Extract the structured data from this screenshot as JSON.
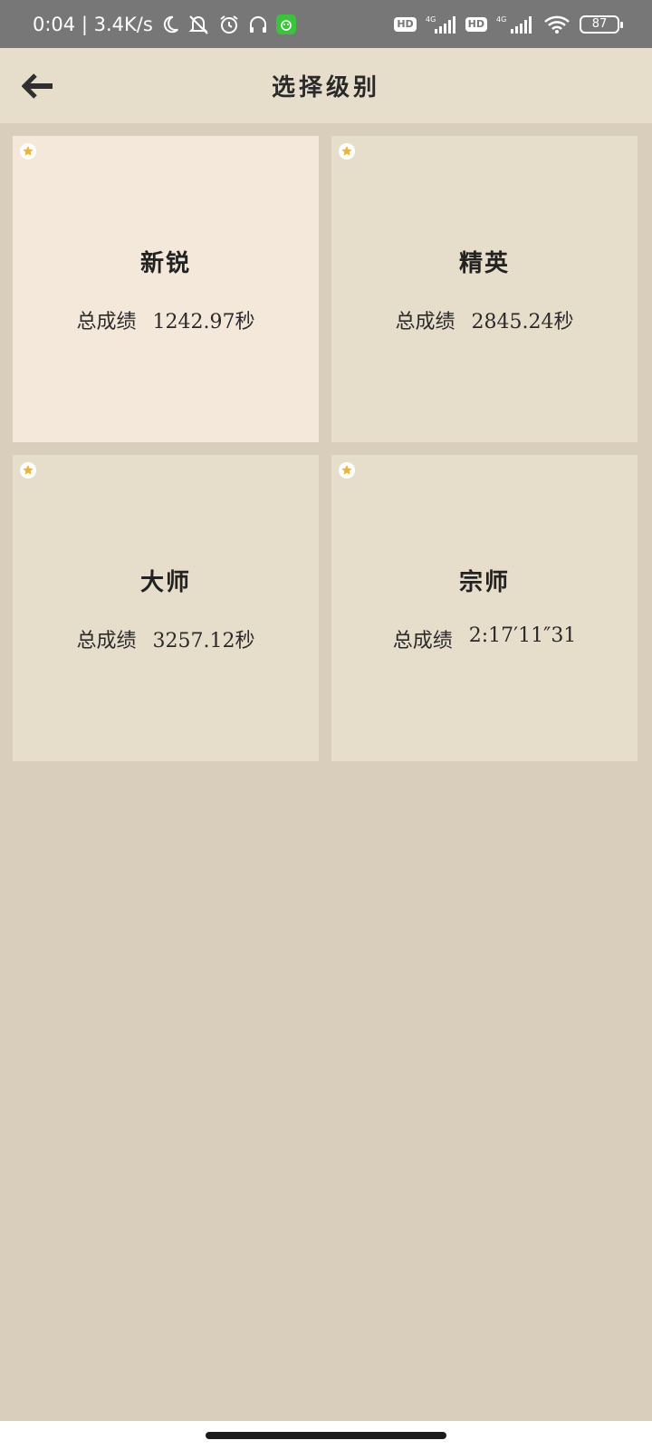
{
  "status_bar": {
    "time_speed": "0:04 | 3.4K/s",
    "battery": "87",
    "icons": [
      "moon-icon",
      "mute-icon",
      "alarm-icon",
      "headphones-icon",
      "app-icon",
      "hd-icon",
      "signal-4g-icon",
      "wifi-icon",
      "battery-icon"
    ],
    "hd_label": "HD",
    "net_label": "4G"
  },
  "header": {
    "title": "选择级别",
    "back_icon": "arrow-left-icon"
  },
  "levels": [
    {
      "name": "新锐",
      "score_label": "总成绩",
      "score_value": "1242.97秒",
      "selected": true
    },
    {
      "name": "精英",
      "score_label": "总成绩",
      "score_value": "2845.24秒",
      "selected": false
    },
    {
      "name": "大师",
      "score_label": "总成绩",
      "score_value": "3257.12秒",
      "selected": false
    },
    {
      "name": "宗师",
      "score_label": "总成绩",
      "score_value": "2:17′11″31",
      "selected": false
    }
  ],
  "colors": {
    "background": "#d9cebb",
    "card": "#e6ddcb",
    "card_selected": "#f3e8da",
    "star": "#f2b234",
    "status_bar": "#777777"
  }
}
